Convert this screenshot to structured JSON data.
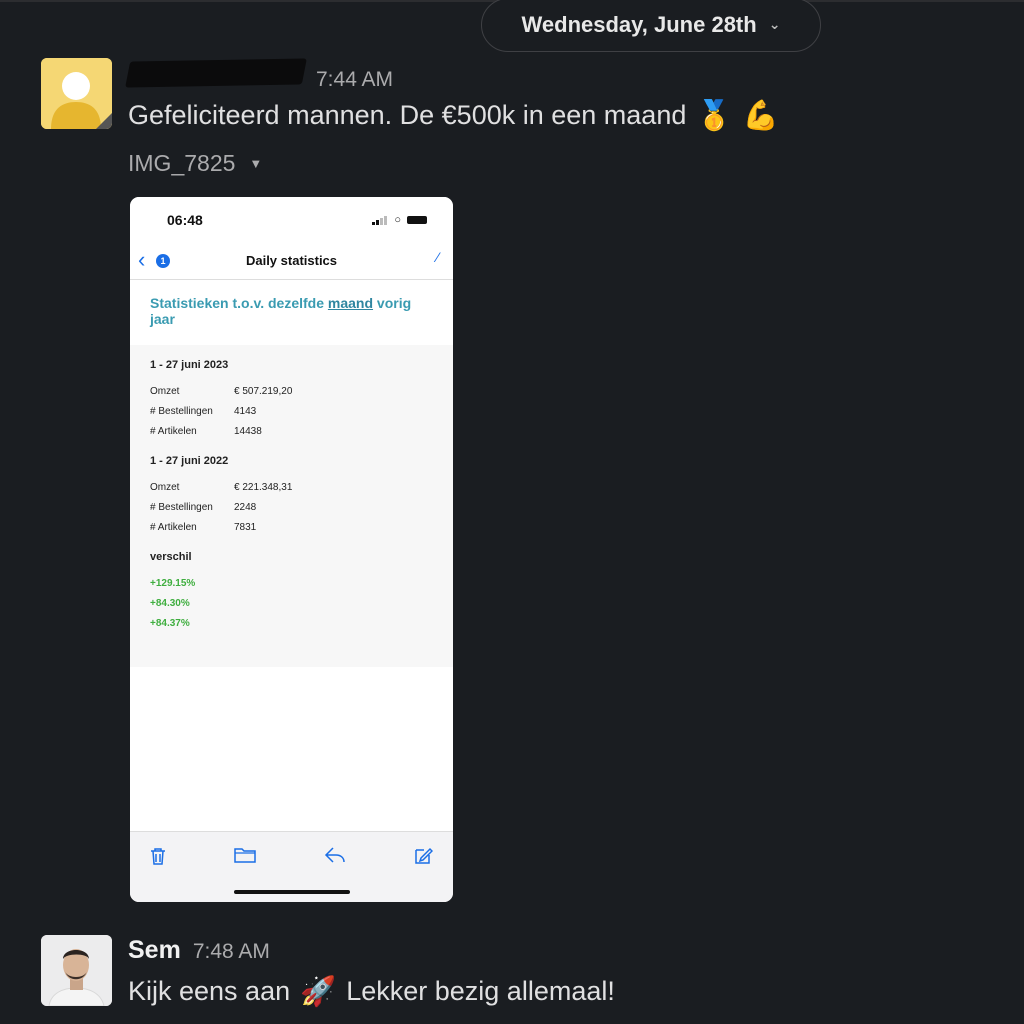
{
  "date_divider": {
    "label": "Wednesday, June 28th",
    "chevron_icon": "chevron-down-icon"
  },
  "messages": [
    {
      "time": "7:44 AM",
      "text": "Gefeliciteerd mannen. De €500k in een maand",
      "emojis": [
        "🥇",
        "💪"
      ],
      "attachment": {
        "name": "IMG_7825",
        "screenshot": {
          "status_time": "06:48",
          "nav_title": "Daily statistics",
          "back_badge": "1",
          "headline_pre": "Statistieken t.o.v. dezelfde ",
          "headline_link": "maand",
          "headline_post": " vorig jaar",
          "periods": [
            {
              "label": "1 - 27 juni 2023",
              "rows": [
                {
                  "k": "Omzet",
                  "v": "€ 507.219,20"
                },
                {
                  "k": "# Bestellingen",
                  "v": "4143"
                },
                {
                  "k": "# Artikelen",
                  "v": "14438"
                }
              ]
            },
            {
              "label": "1 - 27 juni 2022",
              "rows": [
                {
                  "k": "Omzet",
                  "v": "€ 221.348,31"
                },
                {
                  "k": "# Bestellingen",
                  "v": "2248"
                },
                {
                  "k": "# Artikelen",
                  "v": "7831"
                }
              ]
            }
          ],
          "diff_label": "verschil",
          "diffs": [
            "+129.15%",
            "+84.30%",
            "+84.37%"
          ]
        }
      }
    },
    {
      "sender": "Sem",
      "time": "7:48 AM",
      "text_pre": "Kijk eens aan",
      "emoji": "🚀",
      "text_post": "Lekker bezig allemaal!"
    }
  ]
}
